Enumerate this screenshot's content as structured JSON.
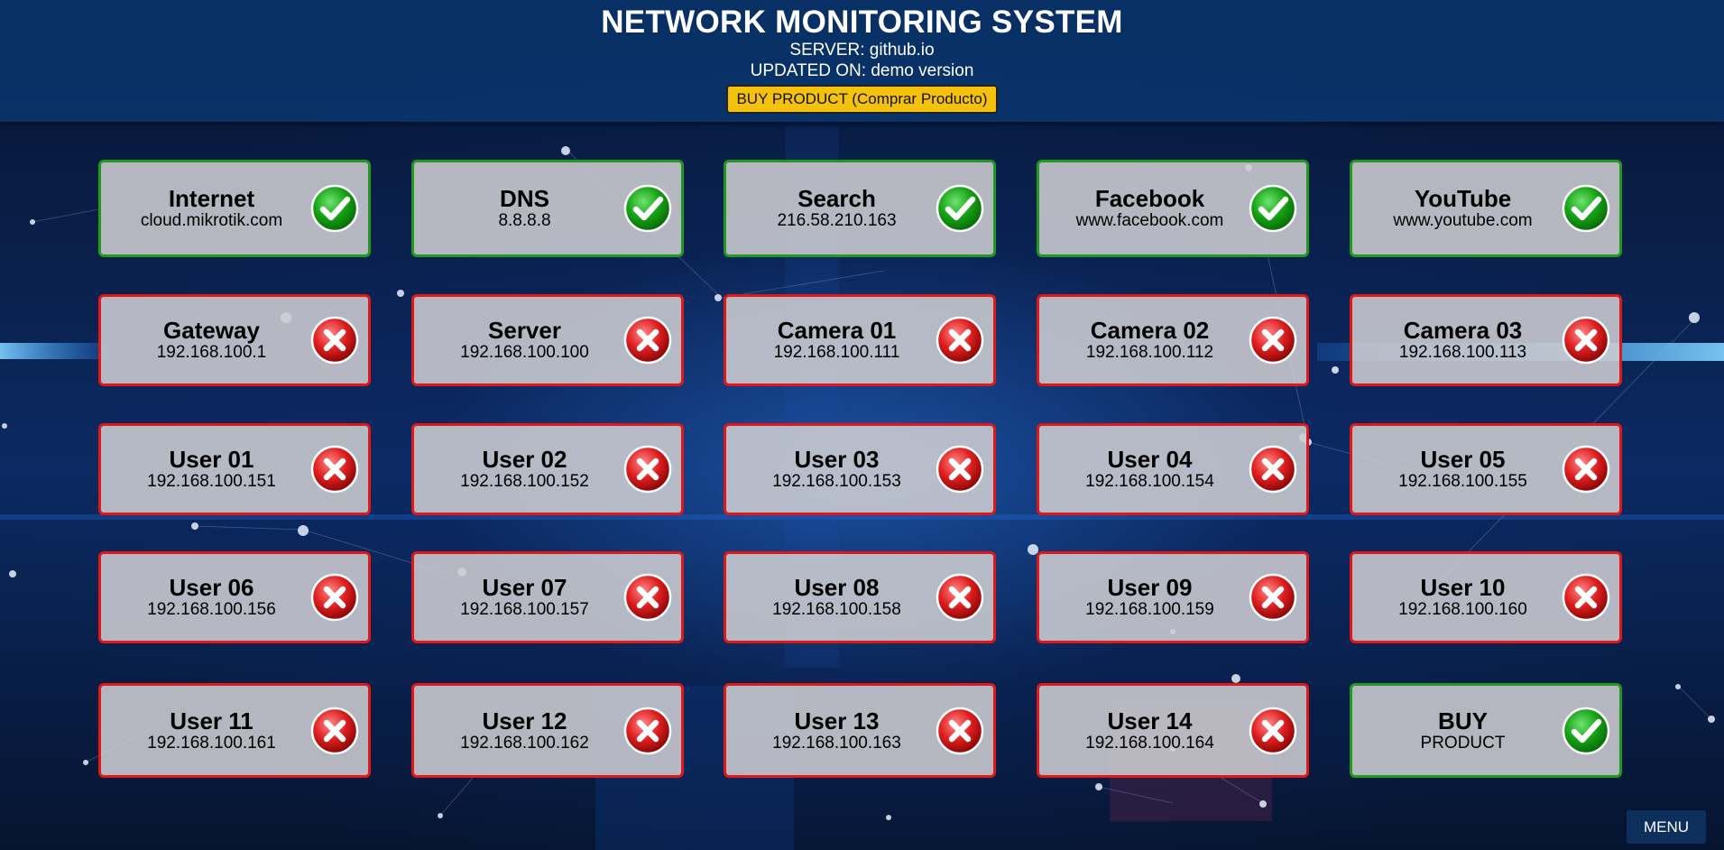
{
  "header": {
    "title": "NETWORK MONITORING SYSTEM",
    "server": "SERVER: github.io",
    "updated": "UPDATED ON: demo version",
    "buy_button": "BUY PRODUCT (Comprar Producto)"
  },
  "devices": [
    {
      "name": "Internet",
      "address": "cloud.mikrotik.com",
      "status": "up"
    },
    {
      "name": "DNS",
      "address": "8.8.8.8",
      "status": "up"
    },
    {
      "name": "Search",
      "address": "216.58.210.163",
      "status": "up"
    },
    {
      "name": "Facebook",
      "address": "www.facebook.com",
      "status": "up"
    },
    {
      "name": "YouTube",
      "address": "www.youtube.com",
      "status": "up"
    },
    {
      "name": "Gateway",
      "address": "192.168.100.1",
      "status": "down"
    },
    {
      "name": "Server",
      "address": "192.168.100.100",
      "status": "down"
    },
    {
      "name": "Camera 01",
      "address": "192.168.100.111",
      "status": "down"
    },
    {
      "name": "Camera 02",
      "address": "192.168.100.112",
      "status": "down"
    },
    {
      "name": "Camera 03",
      "address": "192.168.100.113",
      "status": "down"
    },
    {
      "name": "User 01",
      "address": "192.168.100.151",
      "status": "down"
    },
    {
      "name": "User 02",
      "address": "192.168.100.152",
      "status": "down"
    },
    {
      "name": "User 03",
      "address": "192.168.100.153",
      "status": "down"
    },
    {
      "name": "User 04",
      "address": "192.168.100.154",
      "status": "down"
    },
    {
      "name": "User 05",
      "address": "192.168.100.155",
      "status": "down"
    },
    {
      "name": "User 06",
      "address": "192.168.100.156",
      "status": "down"
    },
    {
      "name": "User 07",
      "address": "192.168.100.157",
      "status": "down"
    },
    {
      "name": "User 08",
      "address": "192.168.100.158",
      "status": "down"
    },
    {
      "name": "User 09",
      "address": "192.168.100.159",
      "status": "down"
    },
    {
      "name": "User 10",
      "address": "192.168.100.160",
      "status": "down"
    },
    {
      "name": "User 11",
      "address": "192.168.100.161",
      "status": "down"
    },
    {
      "name": "User 12",
      "address": "192.168.100.162",
      "status": "down"
    },
    {
      "name": "User 13",
      "address": "192.168.100.163",
      "status": "down"
    },
    {
      "name": "User 14",
      "address": "192.168.100.164",
      "status": "down"
    },
    {
      "name": "BUY",
      "address": "PRODUCT",
      "status": "up"
    }
  ],
  "menu_label": "MENU",
  "colors": {
    "up_border": "#1f9a1f",
    "down_border": "#e01818",
    "card_bg": "#cdcdd2",
    "header_bg": "#0a3c78",
    "buy_button_bg": "#f4c20d",
    "menu_bg": "#0d2f5c"
  },
  "icons": {
    "up": "check-icon",
    "down": "x-icon"
  }
}
